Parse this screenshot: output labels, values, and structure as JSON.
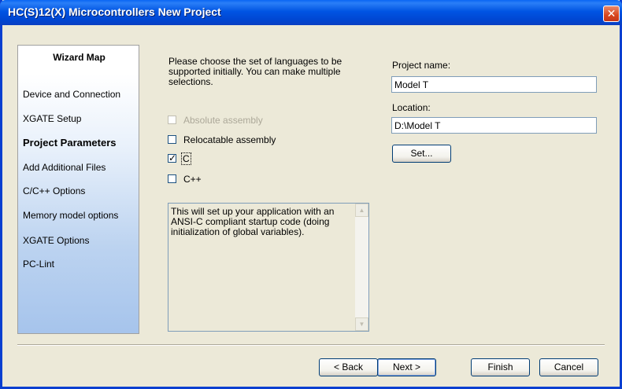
{
  "window": {
    "title": "HC(S)12(X) Microcontrollers New Project",
    "close_glyph": "✕"
  },
  "wizard_map": {
    "title": "Wizard Map",
    "items": [
      {
        "label": "Device and Connection",
        "active": false
      },
      {
        "label": "XGATE Setup",
        "active": false
      },
      {
        "label": "Project Parameters",
        "active": true
      },
      {
        "label": "Add Additional Files",
        "active": false
      },
      {
        "label": "C/C++ Options",
        "active": false
      },
      {
        "label": "Memory model options",
        "active": false
      },
      {
        "label": "XGATE Options",
        "active": false
      },
      {
        "label": "PC-Lint",
        "active": false
      }
    ]
  },
  "languages": {
    "instruction": "Please choose the set of languages to be supported initially. You can make multiple selections.",
    "options": [
      {
        "label": "Absolute assembly",
        "checked": false,
        "enabled": false
      },
      {
        "label": "Relocatable assembly",
        "checked": false,
        "enabled": true
      },
      {
        "label": "C",
        "checked": true,
        "enabled": true
      },
      {
        "label": "C++",
        "checked": false,
        "enabled": true
      }
    ],
    "check_glyph": "✓",
    "description": "This will set up your application with an ANSI-C compliant startup code (doing initialization of global variables).",
    "scroll_up_glyph": "▲",
    "scroll_down_glyph": "▼"
  },
  "project": {
    "name_label": "Project name:",
    "name_value": "Model T",
    "location_label": "Location:",
    "location_value": "D:\\Model T",
    "set_button": "Set..."
  },
  "footer": {
    "back_button": "< Back",
    "next_button": "Next >",
    "finish_button": "Finish",
    "cancel_button": "Cancel"
  },
  "colors": {
    "titlebar": "#0054E3",
    "dialog_bg": "#ECE9D8",
    "close": "#D8461E"
  }
}
